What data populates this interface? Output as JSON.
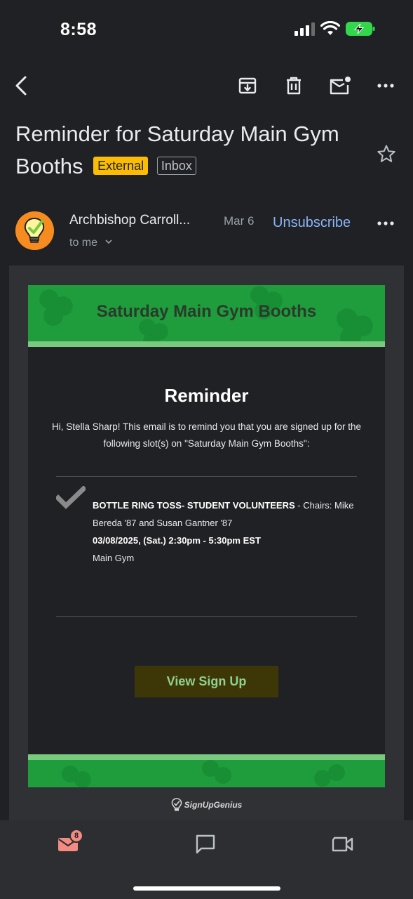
{
  "status_bar": {
    "time": "8:58"
  },
  "toolbar": {
    "back_icon": "chevron-left-icon",
    "archive_icon": "archive-icon",
    "delete_icon": "trash-icon",
    "mark_unread_icon": "mail-unread-icon",
    "more_icon": "more-horizontal-icon"
  },
  "email": {
    "subject": "Reminder for Saturday Main Gym Booths",
    "labels": {
      "external": "External",
      "inbox": "Inbox"
    },
    "sender_name": "Archbishop Carroll...",
    "date": "Mar 6",
    "unsubscribe": "Unsubscribe",
    "recipient": "to me"
  },
  "body": {
    "banner_title": "Saturday Main Gym Booths",
    "reminder_title": "Reminder",
    "intro": "Hi, Stella Sharp! This email is to remind you that you are signed up for the following slot(s) on \"Saturday Main Gym Booths\":",
    "slot_title": "BOTTLE RING TOSS- STUDENT VOLUNTEERS",
    "slot_chairs": " - Chairs: Mike Bereda '87 and Susan Gantner '87",
    "slot_datetime": "03/08/2025, (Sat.) 2:30pm - 5:30pm EST",
    "slot_location": "Main Gym",
    "button_label": "View Sign Up",
    "footer_logo": "SignUpGenius"
  },
  "bottom_nav": {
    "mail_badge": "8"
  },
  "colors": {
    "background": "#202124",
    "external_label": "#fbbc04",
    "link": "#8ab4f8",
    "banner_green": "#1f9d3c",
    "badge": "#f28b82"
  }
}
